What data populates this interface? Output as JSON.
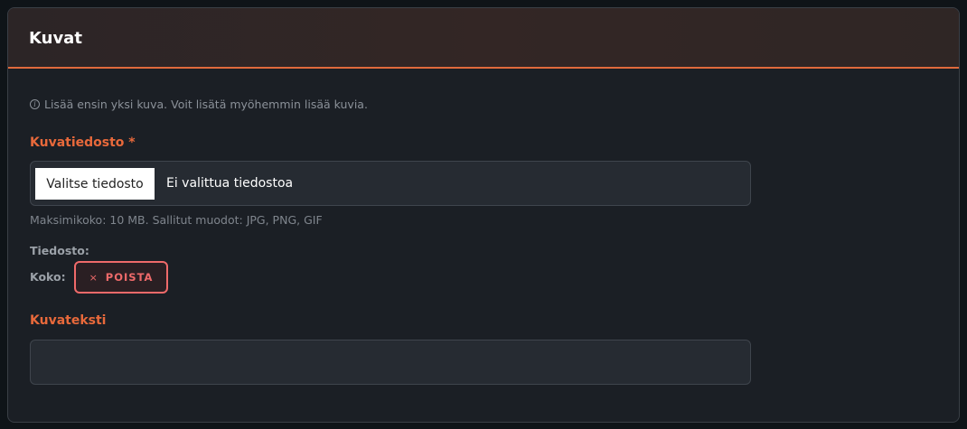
{
  "card": {
    "title": "Kuvat",
    "info_text": "Lisää ensin yksi kuva. Voit lisätä myöhemmin lisää kuvia."
  },
  "file_field": {
    "label": "Kuvatiedosto *",
    "button_label": "Valitse tiedosto",
    "status": "Ei valittua tiedostoa",
    "hint": "Maksimikoko: 10 MB. Sallitut muodot: JPG, PNG, GIF"
  },
  "file_meta": {
    "file_label": "Tiedosto:",
    "size_label": "Koko:",
    "remove_icon": "×",
    "remove_label": "POISTA"
  },
  "caption_field": {
    "label": "Kuvateksti",
    "value": ""
  },
  "colors": {
    "accent": "#e8693b",
    "danger": "#ef6a6a",
    "background": "#1b1f25"
  },
  "icons": [
    "info-icon",
    "close-icon"
  ]
}
